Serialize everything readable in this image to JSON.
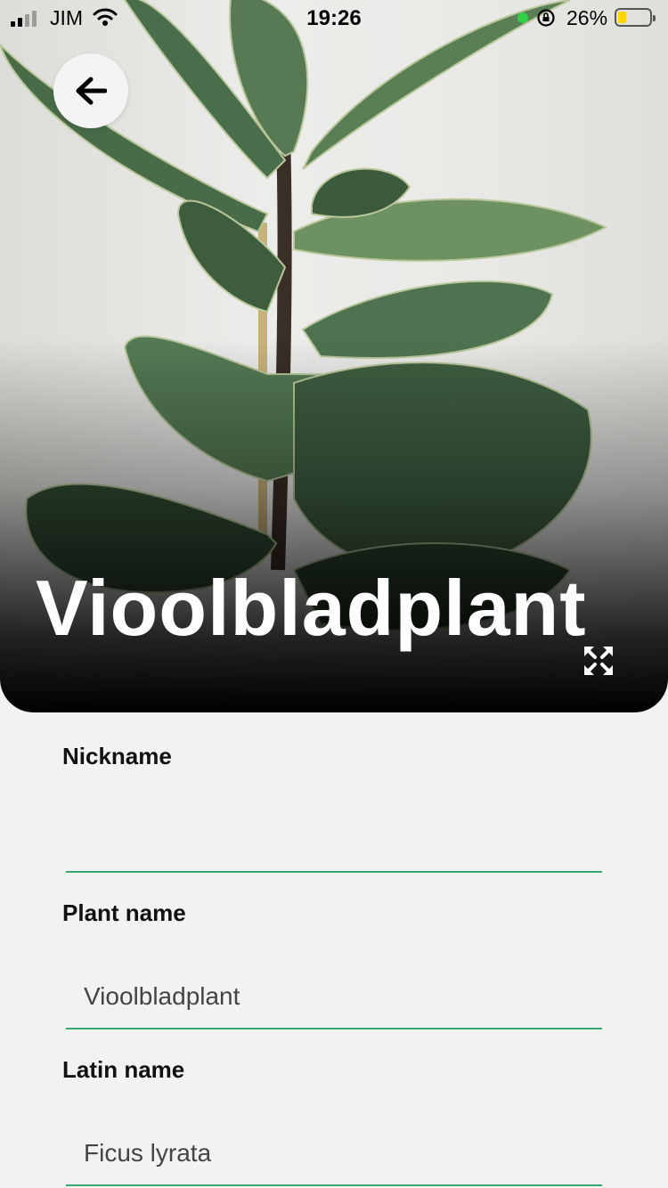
{
  "status_bar": {
    "carrier": "JIM",
    "time": "19:26",
    "battery_percent": "26%",
    "battery_level": 0.26,
    "signal_bars": 2,
    "icons": [
      "signal-icon",
      "wifi-icon",
      "mic-indicator-icon",
      "rotation-lock-icon",
      "battery-icon"
    ]
  },
  "header": {
    "back_icon": "arrow-left-icon",
    "title": "Vioolbladplant",
    "expand_icon": "expand-icon"
  },
  "form": {
    "nickname": {
      "label": "Nickname",
      "value": ""
    },
    "plant_name": {
      "label": "Plant name",
      "value": "Vioolbladplant"
    },
    "latin_name": {
      "label": "Latin name",
      "value": "Ficus lyrata"
    }
  },
  "colors": {
    "accent_underline": "#3aa56e",
    "background": "#f2f2f2",
    "battery_fill": "#ffd400",
    "mic_dot": "#2fcf4a"
  }
}
